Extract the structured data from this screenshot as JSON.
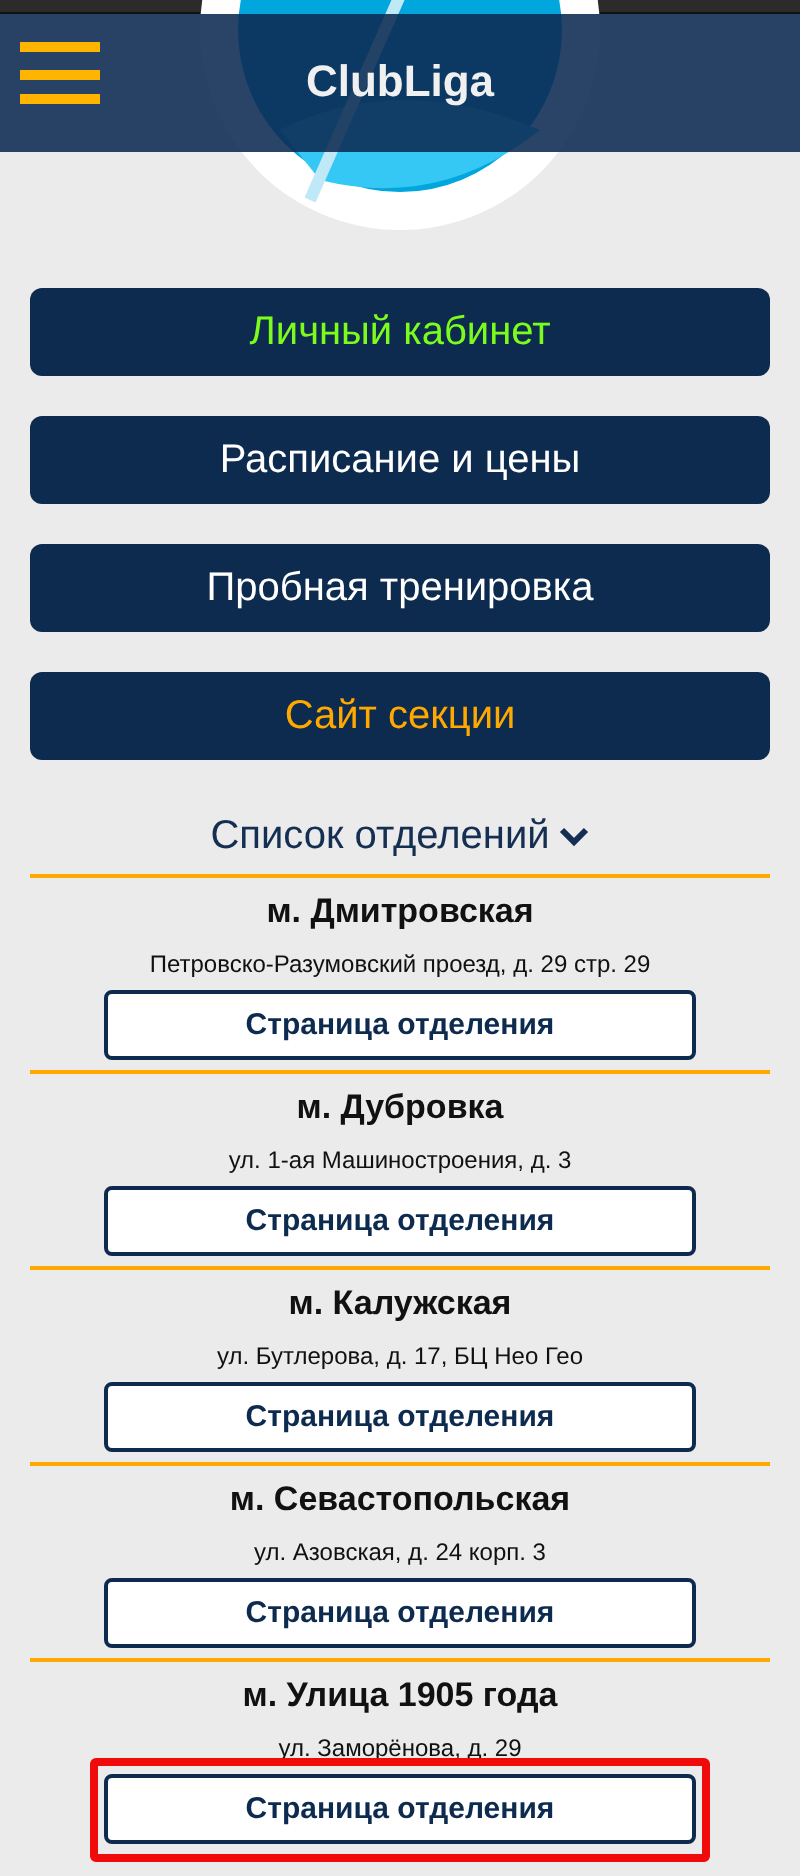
{
  "header": {
    "title": "ClubLiga"
  },
  "menu": [
    {
      "label": "Личный кабинет",
      "kind": "account"
    },
    {
      "label": "Расписание и цены",
      "kind": "plain"
    },
    {
      "label": "Пробная тренировка",
      "kind": "plain"
    },
    {
      "label": "Сайт секции",
      "kind": "site"
    }
  ],
  "branches_heading": {
    "label": "Список отделений",
    "expanded": true
  },
  "branches": [
    {
      "station": "м. Дмитровская",
      "address": "Петровско-Разумовский проезд, д. 29 стр. 29",
      "button": "Страница отделения",
      "highlighted": false
    },
    {
      "station": "м. Дубровка",
      "address": "ул. 1-ая Машиностроения, д. 3",
      "button": "Страница отделения",
      "highlighted": false
    },
    {
      "station": "м. Калужская",
      "address": "ул. Бутлерова, д. 17, БЦ Нео Гео",
      "button": "Страница отделения",
      "highlighted": false
    },
    {
      "station": "м. Севастопольская",
      "address": "ул. Азовская, д. 24 корп. 3",
      "button": "Страница отделения",
      "highlighted": false
    },
    {
      "station": "м. Улица 1905 года",
      "address": "ул. Заморёнова, д. 29",
      "button": "Страница отделения",
      "highlighted": true
    }
  ]
}
